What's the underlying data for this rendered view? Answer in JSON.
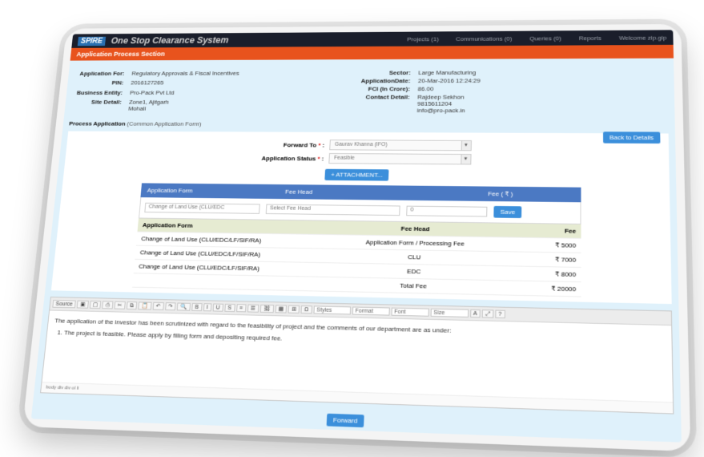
{
  "header": {
    "logo": "SPIRE",
    "system_name": "One Stop Clearance System",
    "nav": [
      "Projects (1)",
      "Communications (0)",
      "Queries (0)",
      "Reports",
      "Welcome zip.gip"
    ]
  },
  "section_title": "Application Process Section",
  "application": {
    "left": [
      {
        "label": "Application For:",
        "value": "Regulatory Approvals & Fiscal Incentives"
      },
      {
        "label": "PIN:",
        "value": "2016127265"
      },
      {
        "label": "Business Entity:",
        "value": "Pro-Pack Pvt Ltd"
      },
      {
        "label": "Site Detail:",
        "value": "Zone1, Ajitgarh\nMohali"
      }
    ],
    "right": [
      {
        "label": "Sector:",
        "value": "Large Manufacturing"
      },
      {
        "label": "ApplicationDate:",
        "value": "20-Mar-2016 12:24:29"
      },
      {
        "label": "FCI (In Crore):",
        "value": "86.00"
      },
      {
        "label": "Contact Detail:",
        "value": "Rajdeep Sekhon\n9815611204\ninfo@pro-pack.in"
      }
    ]
  },
  "process": {
    "title": "Process Application",
    "subtitle": "(Common Application Form)",
    "back_button": "Back to Details",
    "forward_to_label": "Forward To",
    "forward_to_value": "Gaurav Khanna (IFO)",
    "status_label": "Application Status",
    "status_value": "Feasible",
    "attachment_button": "+ ATTACHMENT..."
  },
  "fee_form": {
    "headers": [
      "Application Form",
      "Fee Head",
      "Fee ( ₹ )"
    ],
    "form_select": "Change of Land Use (CLU/EDC",
    "fee_head_select": "Select Fee Head",
    "fee_input": "0",
    "save_button": "Save",
    "table_headers": [
      "Application Form",
      "Fee Head",
      "Fee"
    ],
    "rows": [
      {
        "form": "Change of Land Use (CLU/EDC/LF/SIF/RA)",
        "head": "Application Form / Processing Fee",
        "fee": "₹ 5000"
      },
      {
        "form": "Change of Land Use (CLU/EDC/LF/SIF/RA)",
        "head": "CLU",
        "fee": "₹ 7000"
      },
      {
        "form": "Change of Land Use (CLU/EDC/LF/SIF/RA)",
        "head": "EDC",
        "fee": "₹ 8000"
      }
    ],
    "total_label": "Total Fee",
    "total_value": "₹ 20000"
  },
  "editor": {
    "toolbar_row1": [
      "Source",
      "Cut",
      "Copy",
      "Paste",
      "Undo",
      "Redo",
      "Find",
      "Replace",
      "Select All"
    ],
    "combos": [
      "Styles",
      "Format",
      "Font",
      "Size"
    ],
    "text": "The application of the investor has been scrutinized with regard to the feasibility of project and the comments of our department are as under:",
    "list_item": "The project is feasible. Please apply by filling form and depositing required fee.",
    "path": "body  div  div  ol  li"
  },
  "forward_button": "Forward"
}
